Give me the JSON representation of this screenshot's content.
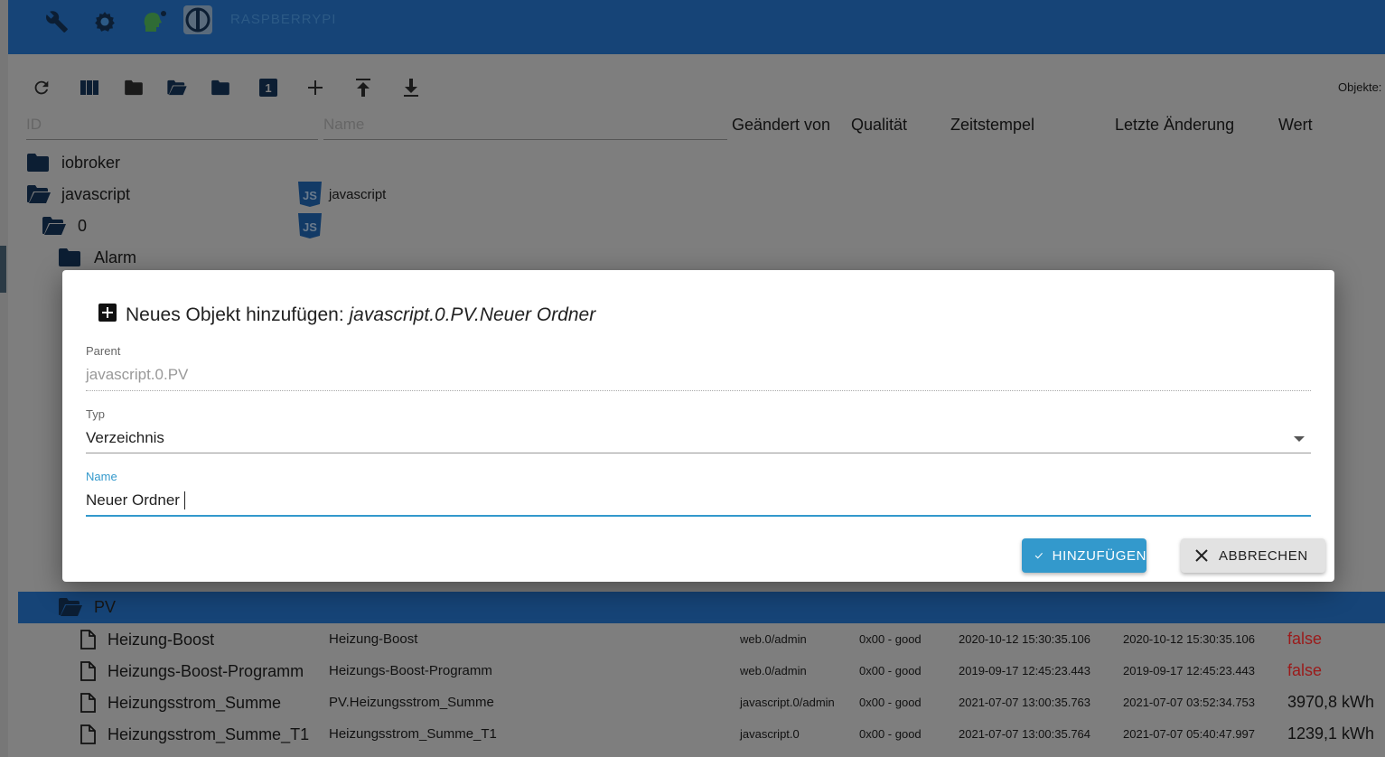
{
  "header": {
    "hostname": "RASPBERRYPI",
    "icons": [
      "wrench-icon",
      "settings-gear-icon",
      "user-head-icon",
      "iobroker-logo"
    ]
  },
  "toolbar": {
    "icons": [
      "refresh-icon",
      "columns-icon",
      "folder-icon",
      "folder-open-icon",
      "folder-icon",
      "number-one-icon",
      "add-icon",
      "upload-icon",
      "download-icon"
    ],
    "objects_label": "Objekte:"
  },
  "filters": {
    "id_placeholder": "ID",
    "name_placeholder": "Name"
  },
  "columns": {
    "changed_by": "Geändert von",
    "quality": "Qualität",
    "timestamp": "Zeitstempel",
    "last_change": "Letzte Änderung",
    "value": "Wert"
  },
  "tree": {
    "iobroker": "iobroker",
    "javascript": "javascript",
    "javascript_name": "javascript",
    "zero": "0",
    "alarm": "Alarm",
    "pv": "PV"
  },
  "rows": [
    {
      "id": "Heizung-Boost",
      "name": "Heizung-Boost",
      "changed_by": "web.0/admin",
      "quality": "0x00 - good",
      "timestamp": "2020-10-12 15:30:35.106",
      "last_change": "2020-10-12 15:30:35.106",
      "value": "false"
    },
    {
      "id": "Heizungs-Boost-Programm",
      "name": "Heizungs-Boost-Programm",
      "changed_by": "web.0/admin",
      "quality": "0x00 - good",
      "timestamp": "2019-09-17 12:45:23.443",
      "last_change": "2019-09-17 12:45:23.443",
      "value": "false"
    },
    {
      "id": "Heizungsstrom_Summe",
      "name": "PV.Heizungsstrom_Summe",
      "changed_by": "javascript.0/admin",
      "quality": "0x00 - good",
      "timestamp": "2021-07-07 13:00:35.763",
      "last_change": "2021-07-07 03:52:34.753",
      "value": "3970,8 kWh"
    },
    {
      "id": "Heizungsstrom_Summe_T1",
      "name": "Heizungsstrom_Summe_T1",
      "changed_by": "javascript.0",
      "quality": "0x00 - good",
      "timestamp": "2021-07-07 13:00:35.764",
      "last_change": "2021-07-07 05:40:47.997",
      "value": "1239,1 kWh"
    }
  ],
  "dialog": {
    "title_prefix": "Neues Objekt hinzufügen:",
    "title_path": "javascript.0.PV.Neuer Ordner",
    "parent_label": "Parent",
    "parent_value": "javascript.0.PV",
    "type_label": "Typ",
    "type_value": "Verzeichnis",
    "name_label": "Name",
    "name_value": "Neuer Ordner",
    "add_button": "HINZUFÜGEN",
    "cancel_button": "ABBRECHEN"
  },
  "colors": {
    "header": "#164477",
    "overlay_bg": "#7e7e7e",
    "primary": "#3399cc",
    "false_value": "#9b1a1a"
  }
}
